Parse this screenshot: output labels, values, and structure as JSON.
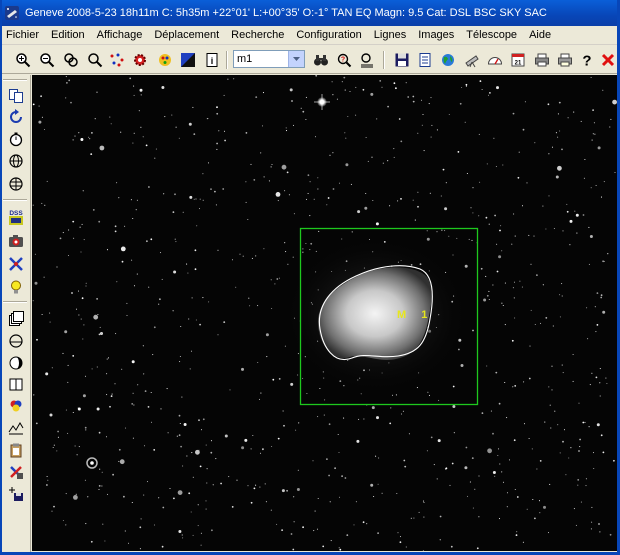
{
  "window": {
    "title": "Geneve 2008-5-23  18h11m C:  5h35m +22°01' L:+00°35' O:-1° TAN EQ Magn: 9.5 Cat: DSL BSC SKY SAC"
  },
  "menu": {
    "items": [
      "Fichier",
      "Edition",
      "Affichage",
      "Déplacement",
      "Recherche",
      "Configuration",
      "Lignes",
      "Images",
      "Télescope",
      "Aide"
    ]
  },
  "toolbar": {
    "object_select": {
      "value": "m1"
    }
  },
  "sky": {
    "objects": [
      {
        "label": "M 1",
        "type": "nebula"
      }
    ]
  },
  "colors": {
    "title_bar": "#0846b8",
    "selection_box": "#1ec81e",
    "object_outline": "#ffffff",
    "object_label": "#e6e61e",
    "sky_background": "#050505"
  }
}
